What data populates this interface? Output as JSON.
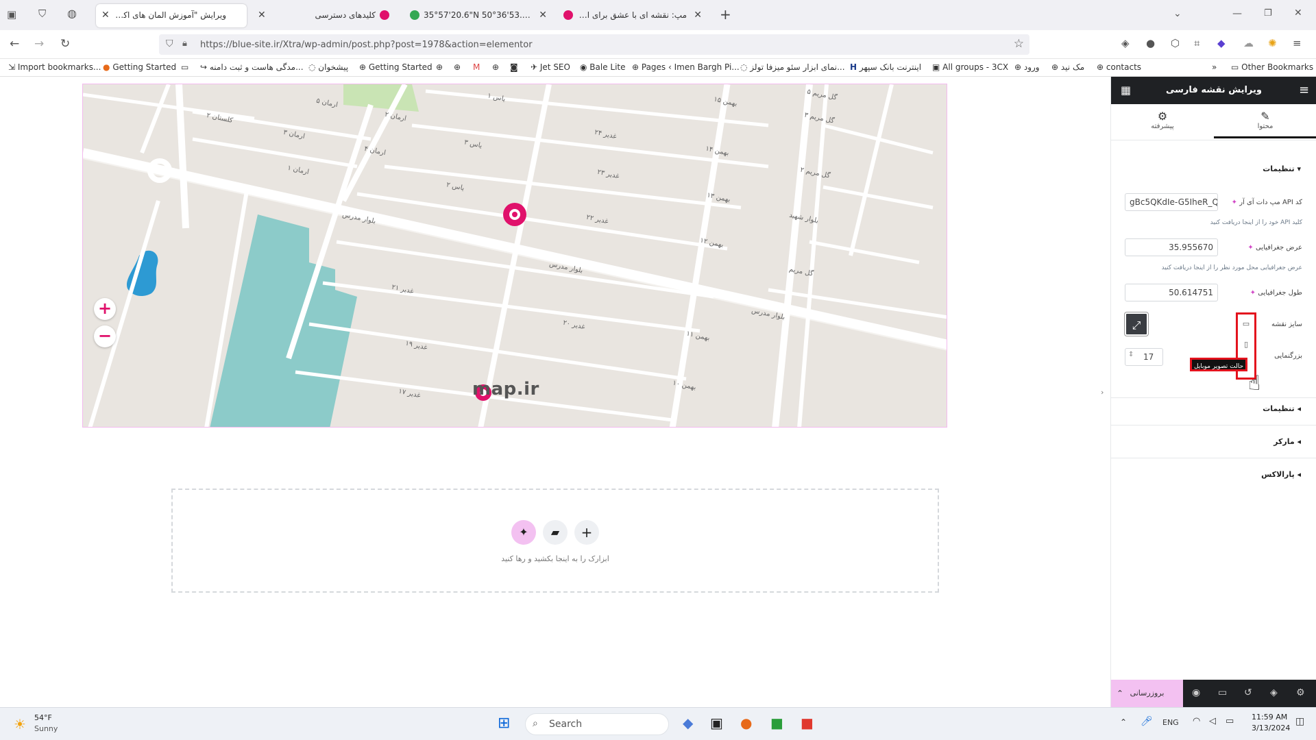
{
  "tabs": [
    {
      "title": "ویرایش \"آموزش المان های اکسترا – ...",
      "active": true,
      "color": "#5b6b7a"
    },
    {
      "title": "کلیدهای دسترسی",
      "active": false,
      "color": "#e0116b"
    },
    {
      "title": "35°57'20.6\"N 50°36'53.2\"E - Goo",
      "active": false,
      "color": "#34a853"
    },
    {
      "title": "مپ: نقشه ای با عشق برای ایران",
      "active": false,
      "color": "#e0116b"
    }
  ],
  "new_tab": "+",
  "url": "https://blue-site.ir/Xtra/wp-admin/post.php?post=1978&action=elementor",
  "bookmarks": [
    "Import bookmarks...",
    "Getting Started",
    "مدگی هاست و ثبت دامنه...",
    "پیشخوان",
    "Getting Started",
    "Jet SEO",
    "Bale Lite",
    "Pages ‹ Imen Bargh Pi...",
    "نمای ابزار سئو میزفا تولز...",
    "اینترنت بانک سپهر",
    "All groups - 3CX",
    "ورود",
    "مک نید",
    "contacts",
    "Other Bookmarks"
  ],
  "map": {
    "zoom_in": "+",
    "zoom_out": "−",
    "logo": "map.ir",
    "streets": [
      "بلوار مدرس",
      "بلوار مدرس",
      "بلوار مدرس",
      "بهمن ۱۵",
      "بهمن ۱۴",
      "بهمن ۱۳",
      "بهمن ۱۲",
      "بهمن ۱۱",
      "بهمن ۱۰",
      "غدیر ۲۲",
      "غدیر ۲۳",
      "غدیر ۲۴",
      "غدیر ۲۰",
      "غدیر ۱۹",
      "غدیر ۱۷",
      "غدیر ۲۱",
      "یاس ۱",
      "یاس ۲",
      "یاس ۳",
      "ارمان ۵",
      "ارمان ۴",
      "ارمان ۳",
      "ارمان ۲",
      "ارمان ۱",
      "کلستان ۲",
      "گل مریم ۵",
      "گل مریم ۳",
      "گل مریم ۲",
      "گل مریم",
      "بلوار شهید"
    ],
    "accent": "#e0116b",
    "park_color": "#8ccbc9",
    "lake_color": "#2d9ad3"
  },
  "dropzone": {
    "hint": "ابزارک را به اینجا بکشید و رها کنید",
    "btn_ai": "✦",
    "btn_template": "▰",
    "btn_add": "+"
  },
  "panel": {
    "title": "ویرایش نقشه فارسی",
    "tab_content": "محتوا",
    "tab_advanced": "پیشرفته",
    "section_settings": "تنظیمات",
    "api_label": "کد API مپ دات آی آر",
    "api_value": "gBc5QKdIe-G5IheR_Q",
    "api_help": "کلید API خود را از اینجا دریافت کنید",
    "lat_label": "عرض جغرافیایی",
    "lat_value": "35.955670",
    "lat_help": "عرض جغرافیایی محل مورد نظر را از اینجا دریافت کنید",
    "lng_label": "طول جغرافیایی",
    "lng_value": "50.614751",
    "size_label": "سایز نقشه",
    "zoom_label": "بزرگنمایی",
    "zoom_value": "17",
    "tooltip": "حالت تصویر موبایل",
    "sect_settings2": "تنظیمات",
    "sect_marker": "مارکر",
    "sect_parallax": "پارالاکس",
    "publish": "بروزرسانی"
  },
  "taskbar": {
    "weather_temp": "54°F",
    "weather_desc": "Sunny",
    "search": "Search",
    "lang": "ENG",
    "time": "11:59 AM",
    "date": "3/13/2024"
  }
}
